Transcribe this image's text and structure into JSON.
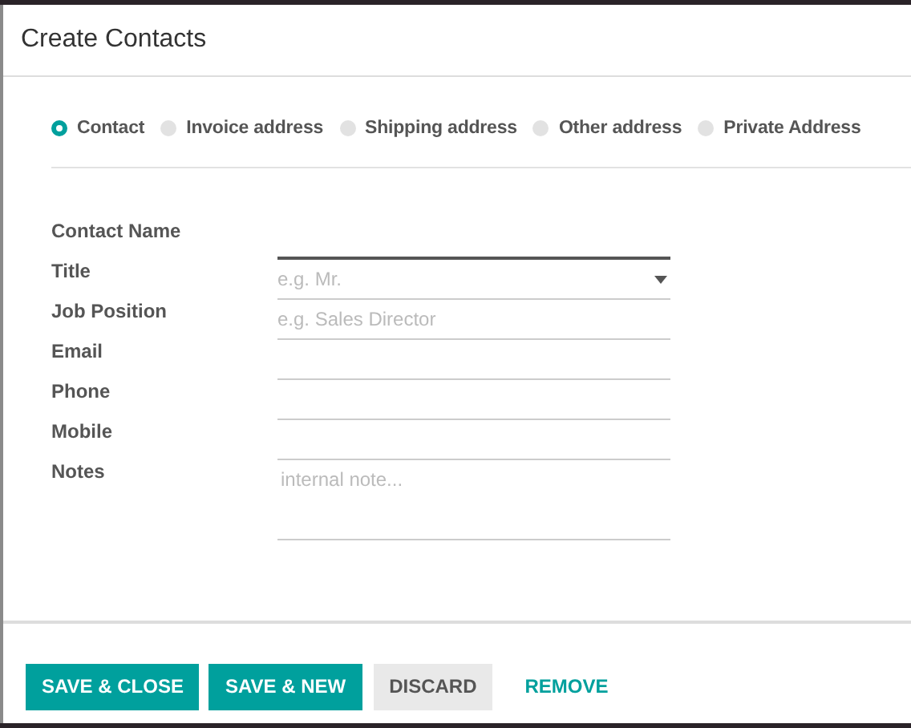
{
  "dialog": {
    "title": "Create Contacts"
  },
  "address_types": [
    {
      "label": "Contact",
      "selected": true
    },
    {
      "label": "Invoice address",
      "selected": false
    },
    {
      "label": "Shipping address",
      "selected": false
    },
    {
      "label": "Other address",
      "selected": false
    },
    {
      "label": "Private Address",
      "selected": false
    }
  ],
  "fields": [
    {
      "label": "Contact Name",
      "kind": "text",
      "focused": true
    },
    {
      "label": "Title",
      "kind": "select",
      "placeholder": "e.g. Mr.",
      "focused": false
    },
    {
      "label": "Job Position",
      "kind": "text",
      "placeholder": "e.g. Sales Director",
      "focused": false
    },
    {
      "label": "Email",
      "kind": "text",
      "focused": false
    },
    {
      "label": "Phone",
      "kind": "text",
      "focused": false
    },
    {
      "label": "Mobile",
      "kind": "text",
      "focused": false
    },
    {
      "label": "Notes",
      "kind": "textarea",
      "placeholder": "internal note...",
      "focused": false
    }
  ],
  "buttons": [
    {
      "label": "SAVE & CLOSE",
      "kind": "primary"
    },
    {
      "label": "SAVE & NEW",
      "kind": "primary"
    },
    {
      "label": "DISCARD",
      "kind": "secondary"
    },
    {
      "label": "REMOVE",
      "kind": "link"
    }
  ]
}
